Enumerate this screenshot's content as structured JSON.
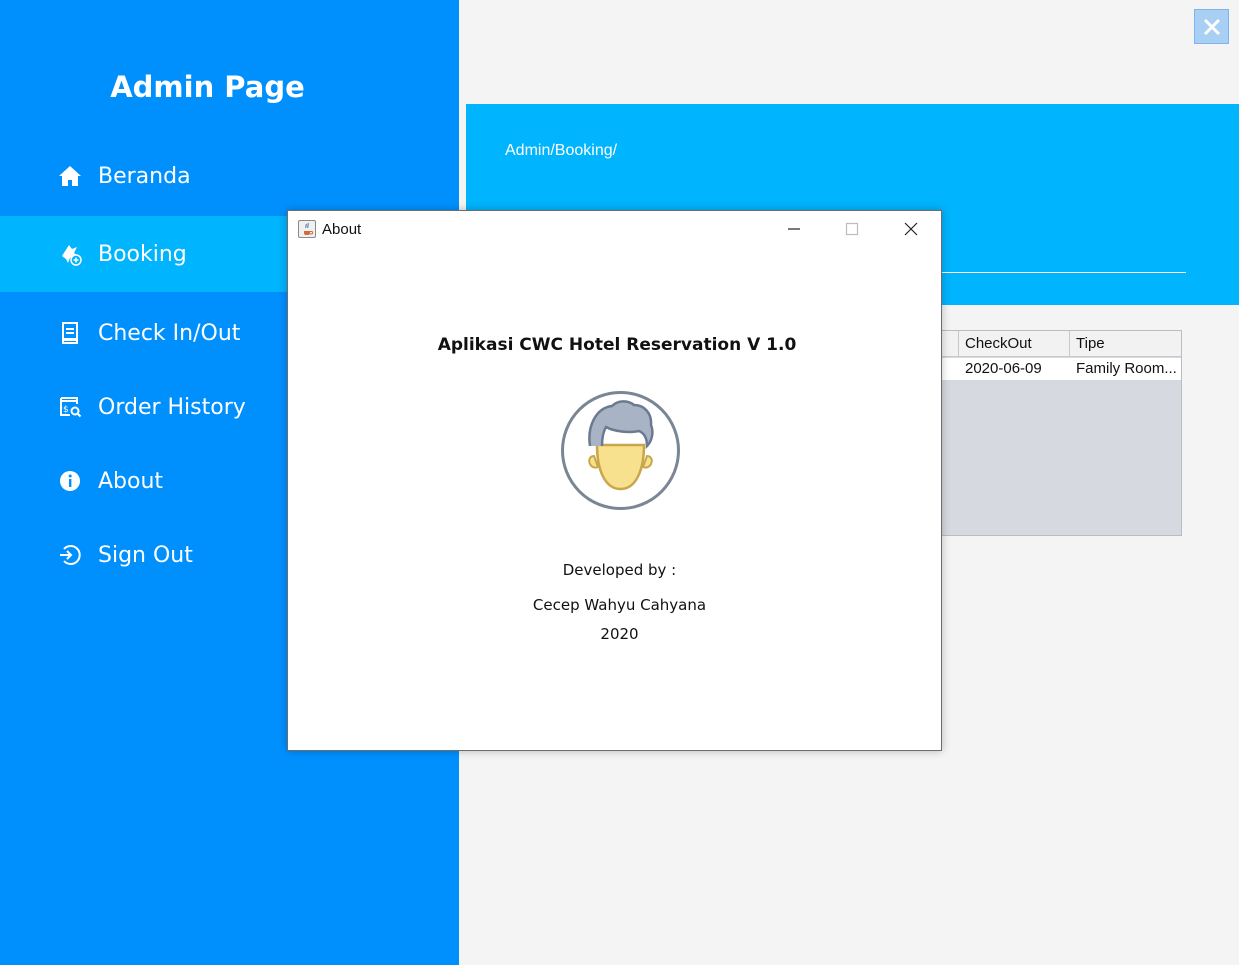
{
  "sidebar": {
    "title": "Admin Page",
    "items": [
      {
        "label": "Beranda",
        "icon": "home-icon"
      },
      {
        "label": "Booking",
        "icon": "booking-icon"
      },
      {
        "label": "Check In/Out",
        "icon": "checkin-icon"
      },
      {
        "label": "Order History",
        "icon": "order-history-icon"
      },
      {
        "label": "About",
        "icon": "info-icon"
      },
      {
        "label": "Sign Out",
        "icon": "sign-out-icon"
      }
    ],
    "active": "Booking"
  },
  "header": {
    "breadcrumb": "Admin/Booking/"
  },
  "table": {
    "columns": [
      "CheckOut",
      "Tipe"
    ],
    "rows": [
      [
        "2020-06-09",
        "Family Room..."
      ]
    ]
  },
  "dialog": {
    "title": "About",
    "app_name": "Aplikasi CWC Hotel Reservation V 1.0",
    "developed_by_label": "Developed by :",
    "developer": "Cecep Wahyu Cahyana",
    "year": "2020"
  },
  "colors": {
    "sidebar": "#0090fe",
    "active_item": "#00b4fe",
    "header_band": "#00b4fe",
    "content_bg": "#f4f4f4"
  }
}
